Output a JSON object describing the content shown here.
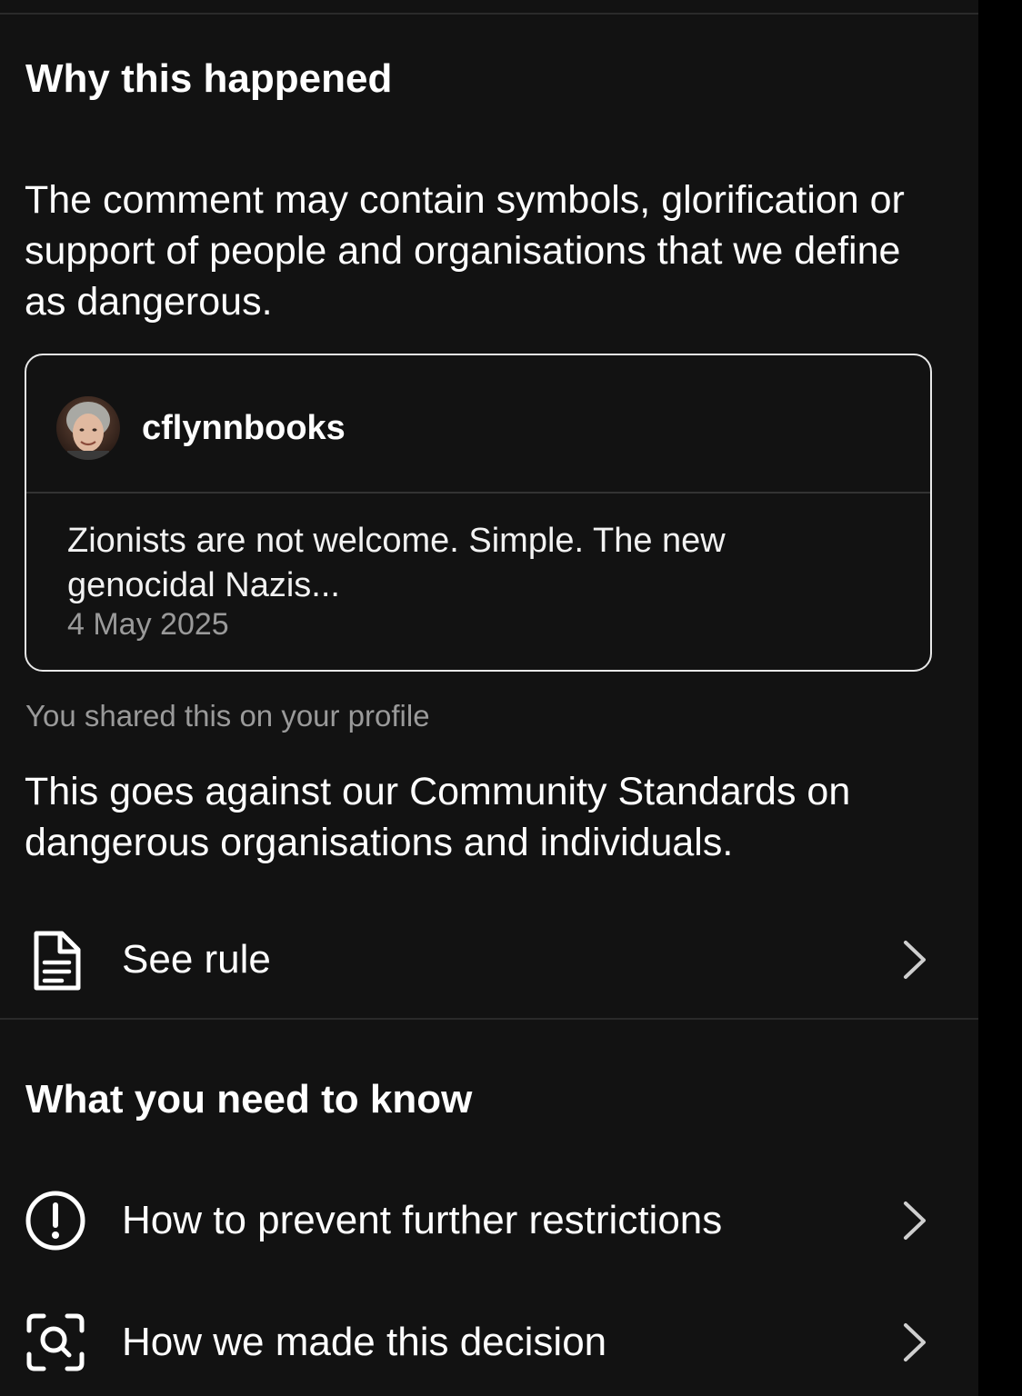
{
  "section_why": {
    "title": "Why this happened",
    "explanation": "The comment may contain symbols, glorification or support of people and organisations that we define as dangerous."
  },
  "comment_card": {
    "username": "cflynnbooks",
    "text": "Zionists are not welcome. Simple. The new genocidal Nazis...",
    "date": "4 May 2025"
  },
  "shared_note": "You shared this on your profile",
  "standards_text": "This goes against our Community Standards on dangerous organisations and individuals.",
  "see_rule": {
    "label": "See rule",
    "icon": "document-icon"
  },
  "section_know": {
    "title": "What you need to know",
    "items": [
      {
        "label": "How to prevent further restrictions",
        "icon": "exclamation-circle-icon"
      },
      {
        "label": "How we made this decision",
        "icon": "scan-search-icon"
      }
    ]
  },
  "colors": {
    "background": "#121212",
    "text_primary": "#ffffff",
    "text_secondary": "#9a9a9a",
    "card_border": "#e8e8e8"
  }
}
